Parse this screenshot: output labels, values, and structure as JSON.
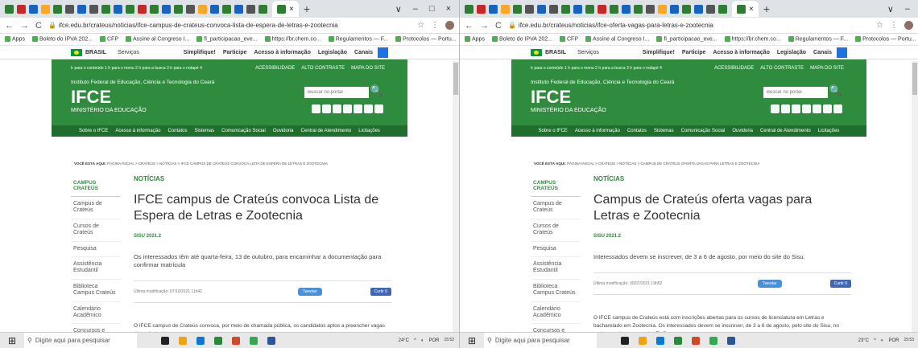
{
  "panes": [
    {
      "tab_favicons": [
        "g",
        "r",
        "b",
        "y",
        "g",
        "k",
        "b",
        "k",
        "g",
        "b",
        "g",
        "r",
        "g",
        "b",
        "g",
        "k",
        "y",
        "b",
        "g",
        "b",
        "k",
        "g"
      ],
      "tab_close": "×",
      "tab_new": "+",
      "window_controls": [
        "∨",
        "–",
        "□",
        "×"
      ],
      "url": "ifce.edu.br/crateus/noticias/ifce-campus-de-crateus-convoca-lista-de-espera-de-letras-e-zootecnia",
      "bookmarks": [
        "Apps",
        "Boleto do IPVA 202...",
        "CFP",
        "Assine al Congreso I...",
        "fi_participacao_eve...",
        "https://br.chem.co...",
        "Regulamentos — F...",
        "Protocolos — Portu...",
        "O novo coronavírus...",
        "Lista de leitura"
      ],
      "gov": {
        "brasil": "BRASIL",
        "servicos": "Serviços",
        "links": [
          "Simplifique!",
          "Participe",
          "Acesso à informação",
          "Legislação",
          "Canais"
        ]
      },
      "header": {
        "skip": "Ir para o conteúdo  1   Ir para o menu  2   Ir para a busca  3   Ir para o rodapé  4",
        "access": [
          "ACESSIBILIDADE",
          "ALTO CONTRASTE",
          "MAPA DO SITE"
        ],
        "institution": "Instituto Federal de Educação, Ciência e Tecnologia do Ceará",
        "logo": "IFCE",
        "ministry": "MINISTÉRIO DA EDUCAÇÃO",
        "search_placeholder": "Buscar no portal"
      },
      "nav": [
        "Sobre o IFCE",
        "Acesso à informação",
        "Contatos",
        "Sistemas",
        "Comunicação Social",
        "Ouvidoria",
        "Central de Atendimento",
        "Licitações"
      ],
      "breadcrumb_label": "VOCÊ ESTÁ AQUI:",
      "breadcrumb": "PÁGINA INICIAL > CRATEÚS > NOTÍCIAS > IFCE CAMPUS DE CRATEÚS CONVOCA LISTA DE ESPERA DE LETRAS E ZOOTECNIA",
      "sidebar": {
        "title": "CAMPUS CRATEÚS",
        "items": [
          "Campus de Crateús",
          "Cursos de Crateús",
          "Pesquisa",
          "Assistência Estudantil",
          "Biblioteca Campus Crateús",
          "Calendário Acadêmico",
          "Concursos e Seleções do"
        ]
      },
      "article": {
        "category": "NOTÍCIAS",
        "title": "IFCE campus de Crateús convoca Lista de Espera de Letras e Zootecnia",
        "subject": "SISU 2021.2",
        "lead": "Os interessados têm até quarta-feira, 13 de outubro, para encaminhar a documentação para confirmar matrícula",
        "modified": "Última modificação: 07/10/2021 11h42",
        "tweet": "Tweetar",
        "like": "Curtir 0",
        "body": "O IFCE campus de Crateús convoca, por meio de chamada pública, os candidatos aptos a preencher vagas disponíveis dos"
      },
      "taskbar": {
        "search": "Digite aqui para pesquisar",
        "temp": "24°C",
        "lang": "POR",
        "time": "15:52"
      }
    },
    {
      "tab_favicons": [
        "g",
        "r",
        "b",
        "y",
        "g",
        "k",
        "b",
        "k",
        "g",
        "b",
        "g",
        "r",
        "g",
        "b",
        "g",
        "k",
        "y",
        "b",
        "g",
        "b",
        "k",
        "g"
      ],
      "tab_close": "×",
      "tab_new": "+",
      "window_controls": [
        "∨",
        "–"
      ],
      "url": "ifce.edu.br/crateus/noticias/ifce-oferta-vagas-para-letras-e-zootecnia",
      "bookmarks": [
        "Apps",
        "Boleto do IPVA 202...",
        "CFP",
        "Assine al Congreso I...",
        "fi_participacao_eve...",
        "https://br.chem.co...",
        "Regulamentos — F...",
        "Protocolos — Portu...",
        "O novo coronavírus...",
        "Lista de lei"
      ],
      "gov": {
        "brasil": "BRASIL",
        "servicos": "Serviços",
        "links": [
          "Simplifique!",
          "Participe",
          "Acesso à informação",
          "Legislação",
          "Canais"
        ]
      },
      "header": {
        "skip": "Ir para o conteúdo  1   Ir para o menu  2   Ir para a busca  3   Ir para o rodapé  4",
        "access": [
          "ACESSIBILIDADE",
          "ALTO CONTRASTE",
          "MAPA DO SITE"
        ],
        "institution": "Instituto Federal de Educação, Ciência e Tecnologia do Ceará",
        "logo": "IFCE",
        "ministry": "MINISTÉRIO DA EDUCAÇÃO",
        "search_placeholder": "Buscar no portal"
      },
      "nav": [
        "Sobre o IFCE",
        "Acesso à informação",
        "Contatos",
        "Sistemas",
        "Comunicação Social",
        "Ouvidoria",
        "Central de Atendimento",
        "Licitações"
      ],
      "breadcrumb_label": "VOCÊ ESTÁ AQUI:",
      "breadcrumb": "PÁGINA INICIAL > CRATEÚS > NOTÍCIAS > CAMPUS DE CRATEÚS OFERTA VAGAS PARA LETRAS E ZOOTECNIA",
      "sidebar": {
        "title": "CAMPUS CRATEÚS",
        "items": [
          "Campus de Crateús",
          "Cursos de Crateús",
          "Pesquisa",
          "Assistência Estudantil",
          "Biblioteca Campus Crateús",
          "Calendário Acadêmico",
          "Concursos e Seleções do"
        ]
      },
      "article": {
        "category": "NOTÍCIAS",
        "title": "Campus de Crateús oferta vagas para Letras e Zootecnia",
        "subject": "SISU 2021.2",
        "lead": "Interessados devem se inscrever, de 3 a 6 de agosto, por meio do site do Sisu.",
        "modified": "Última modificação: 30/07/2021 19h52",
        "tweet": "Tweetar",
        "like": "Curtir 0",
        "body": "O IFCE campus de Crateús está com inscrições abertas para os cursos de licenciatura em Letras e bacharelado em Zootecnia. Os interessados devem se inscrever, de 3 a 6 de agosto, pelo site do Sisu, no endereço sisu.mec.gov.br. Estão"
      },
      "taskbar": {
        "search": "Digite aqui para pesquisar",
        "temp": "23°C",
        "lang": "POR",
        "time": "15:53"
      }
    }
  ]
}
